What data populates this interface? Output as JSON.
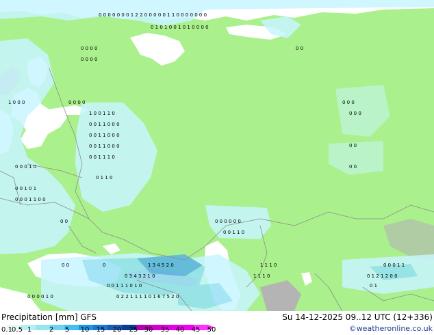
{
  "footer": {
    "title": "Precipitation [mm] GFS",
    "datetime": "Su 14-12-2025 09..12 UTC (12+336)",
    "watermark": "©weatheronline.co.uk"
  },
  "legend": {
    "labels": [
      "0.1",
      "0.5",
      "1",
      "2",
      "5",
      "10",
      "15",
      "20",
      "25",
      "30",
      "35",
      "40",
      "45",
      "50"
    ],
    "colors": [
      "#e6fafa",
      "#b4f0f0",
      "#96e6f0",
      "#6ed2f0",
      "#46bef0",
      "#1e96e6",
      "#1e78d2",
      "#1e5ab4",
      "#0a3c96",
      "#b400b4",
      "#d200d2",
      "#e600e6",
      "#f000f0",
      "#ff32ff"
    ]
  },
  "map_colors": {
    "land": "#aaf08c",
    "sea": "#ffffff",
    "high_terrain": "#b4b4b4",
    "precip_light": "#c8f5ff",
    "precip_mid": "#96e1f5",
    "precip_heavy": "#5ab4e6",
    "borders": "#8c8c8c"
  }
}
